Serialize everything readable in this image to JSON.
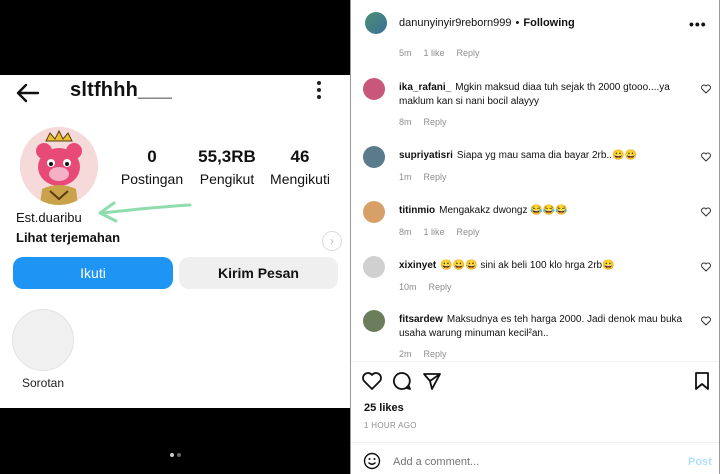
{
  "profile": {
    "username": "sltfhhh___",
    "stats": [
      {
        "value": "0",
        "label": "Postingan"
      },
      {
        "value": "55,3RB",
        "label": "Pengikut"
      },
      {
        "value": "46",
        "label": "Mengikuti"
      }
    ],
    "bio_name": "Est.duaribu",
    "translate_label": "Lihat terjemahan",
    "follow_label": "Ikuti",
    "message_label": "Kirim Pesan",
    "highlight_label": "Sorotan"
  },
  "post": {
    "author": "danunyinyir9reborn999",
    "separator": "•",
    "follow_state": "Following",
    "more": "•••",
    "top_meta": {
      "time": "5m",
      "likes": "1 like",
      "reply": "Reply"
    },
    "comments": [
      {
        "user": "ika_rafani_",
        "text": "Mgkin maksud diaa tuh sejak th 2000 gtooo....ya maklum kan si nani bocil alayyy",
        "time": "8m",
        "likes": "",
        "reply": "Reply",
        "avatar_color": "#c9577a"
      },
      {
        "user": "supriyatisri",
        "text": "Siapa yg mau sama dia bayar 2rb..😀😀",
        "time": "1m",
        "likes": "",
        "reply": "Reply",
        "avatar_color": "#5a7b8c"
      },
      {
        "user": "titinmio",
        "text": "Mengakakz dwongz 😂😂😂",
        "time": "8m",
        "likes": "1 like",
        "reply": "Reply",
        "avatar_color": "#d6a068"
      },
      {
        "user": "xixinyet",
        "text": "😀😀😀 sini ak beli 100 klo hrga 2rb😀",
        "time": "10m",
        "likes": "",
        "reply": "Reply",
        "avatar_color": "#d0d0d0"
      },
      {
        "user": "fitsardew",
        "text": "Maksudnya es teh harga 2000. Jadi denok mau buka usaha warung minuman kecil²an..",
        "time": "2m",
        "likes": "",
        "reply": "Reply",
        "avatar_color": "#6b7d5a"
      }
    ],
    "likes_count": "25 likes",
    "time_ago": "1 HOUR AGO",
    "add_comment_placeholder": "Add a comment...",
    "post_label": "Post"
  },
  "colors": {
    "follow_blue": "#1e95f4",
    "green_annotation": "#8fdcae",
    "muted_text": "#8e8e8e"
  }
}
